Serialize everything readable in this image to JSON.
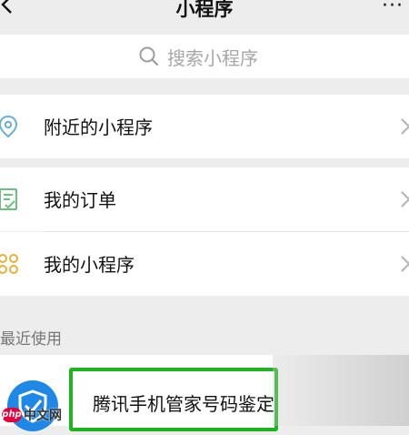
{
  "header": {
    "title": "小程序",
    "more": "···"
  },
  "search": {
    "placeholder": "搜索小程序"
  },
  "menu": {
    "nearby": "附近的小程序",
    "orders": "我的订单",
    "my_apps": "我的小程序"
  },
  "recent": {
    "section_label": "最近使用",
    "app_name": "腾讯手机管家号码鉴定"
  },
  "watermark": {
    "logo": "php",
    "text": "中文网"
  },
  "colors": {
    "highlight_border": "#1db51d",
    "icon_green": "#6dbf7f",
    "icon_yellow": "#e8b23a",
    "icon_blue": "#1f87e6"
  }
}
